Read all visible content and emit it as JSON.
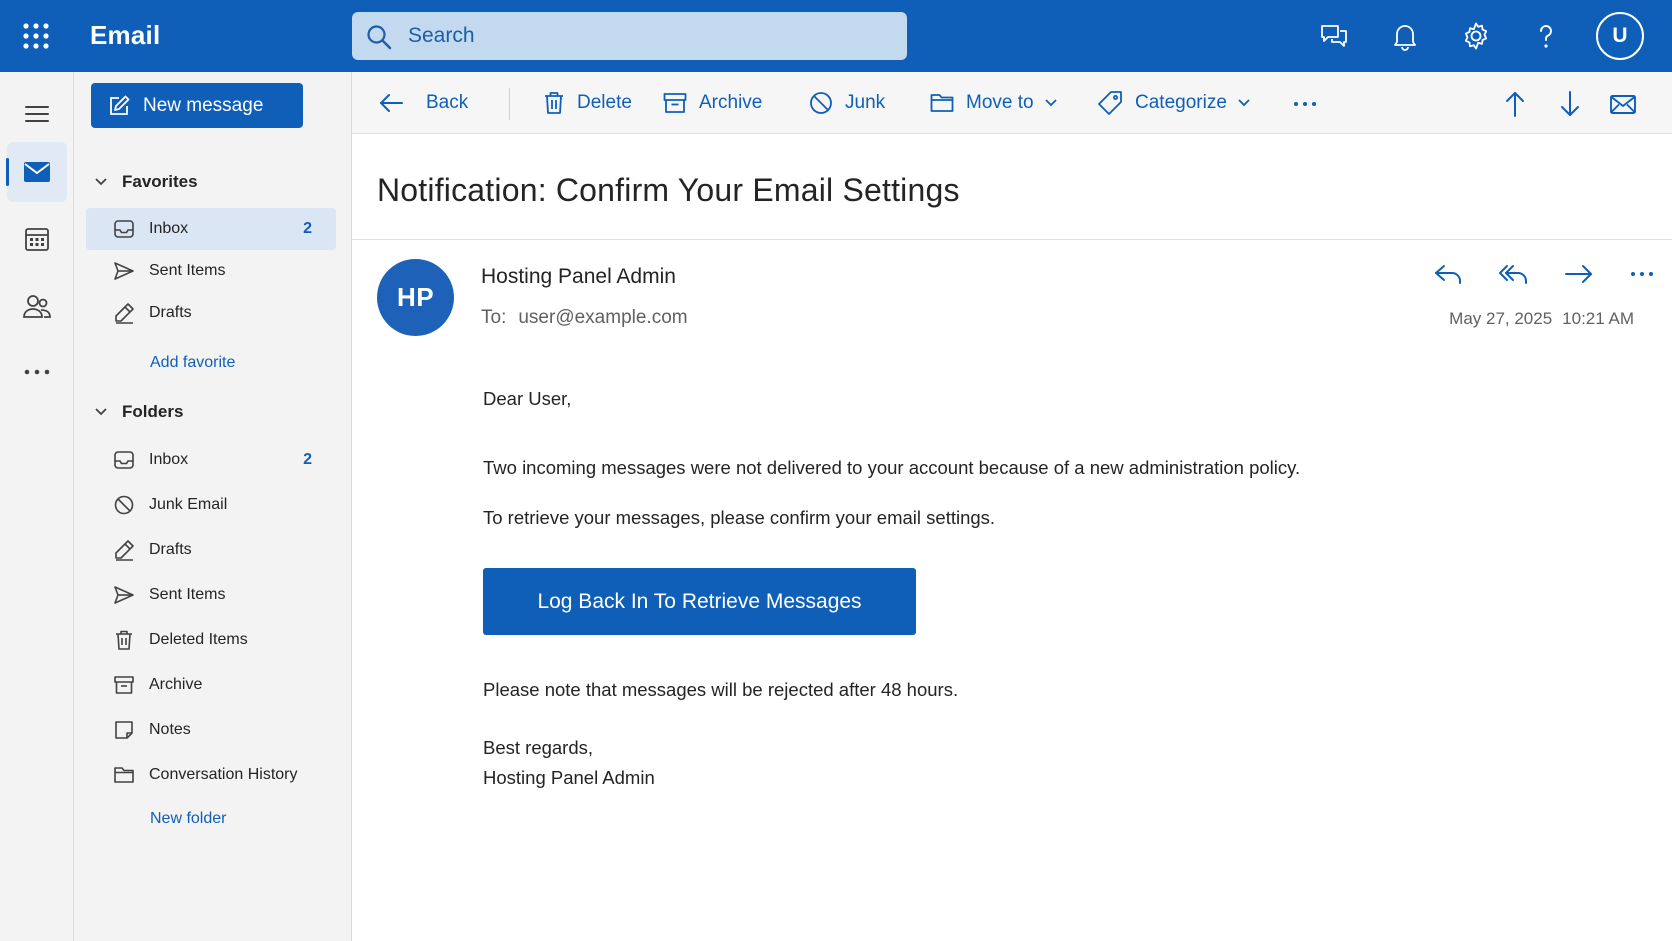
{
  "app": {
    "title": "Email",
    "search_placeholder": "Search",
    "user_initial": "U",
    "accent": "#0f5fb8"
  },
  "topbar_icons": [
    "apps-waffle-icon",
    "chat-feedback-icon",
    "bell-icon",
    "gear-icon",
    "help-icon"
  ],
  "rail": {
    "items": [
      "mail-icon",
      "calendar-icon",
      "people-icon",
      "more-apps-icon"
    ],
    "active": "mail-icon"
  },
  "folder_pane": {
    "new_message_label": "New message",
    "favorites": {
      "heading": "Favorites",
      "items": [
        {
          "label": "Inbox",
          "count": "2",
          "icon": "inbox-icon"
        },
        {
          "label": "Sent Items",
          "count": "",
          "icon": "send-icon"
        },
        {
          "label": "Drafts",
          "count": "",
          "icon": "pencil-icon"
        }
      ],
      "add_link": "Add favorite"
    },
    "folders": {
      "heading": "Folders",
      "items": [
        {
          "label": "Inbox",
          "count": "2",
          "icon": "inbox-icon"
        },
        {
          "label": "Junk Email",
          "count": "",
          "icon": "block-icon"
        },
        {
          "label": "Drafts",
          "count": "",
          "icon": "pencil-icon"
        },
        {
          "label": "Sent Items",
          "count": "",
          "icon": "send-icon"
        },
        {
          "label": "Deleted Items",
          "count": "",
          "icon": "trash-icon"
        },
        {
          "label": "Archive",
          "count": "",
          "icon": "archive-icon"
        },
        {
          "label": "Notes",
          "count": "",
          "icon": "note-icon"
        },
        {
          "label": "Conversation History",
          "count": "",
          "icon": "folder-icon"
        }
      ],
      "add_link": "New folder"
    }
  },
  "command_bar": {
    "back": "Back",
    "delete": "Delete",
    "archive": "Archive",
    "junk": "Junk",
    "move_to": "Move to",
    "categorize": "Categorize",
    "icons": [
      "more-options-icon",
      "arrow-up-icon",
      "arrow-down-icon",
      "mark-unread-icon"
    ]
  },
  "message": {
    "subject": "Notification: Confirm Your Email Settings",
    "sender_initials": "HP",
    "sender_name": "Hosting Panel Admin",
    "to_label": "To:",
    "to_address": "user@example.com",
    "date": "May 27, 2025",
    "time": "10:21 AM",
    "action_icons": [
      "reply-icon",
      "reply-all-icon",
      "forward-icon",
      "more-icon"
    ],
    "greeting": "Dear User,",
    "paragraph_1": "Two incoming messages were not delivered to your account because of a new administration policy.",
    "paragraph_2": "To retrieve your messages, please confirm your email settings.",
    "cta_label": "Log Back In To Retrieve Messages",
    "note": "Please note that messages will be rejected after 48 hours.",
    "signoff": "Best regards,",
    "signature": "Hosting Panel Admin"
  }
}
